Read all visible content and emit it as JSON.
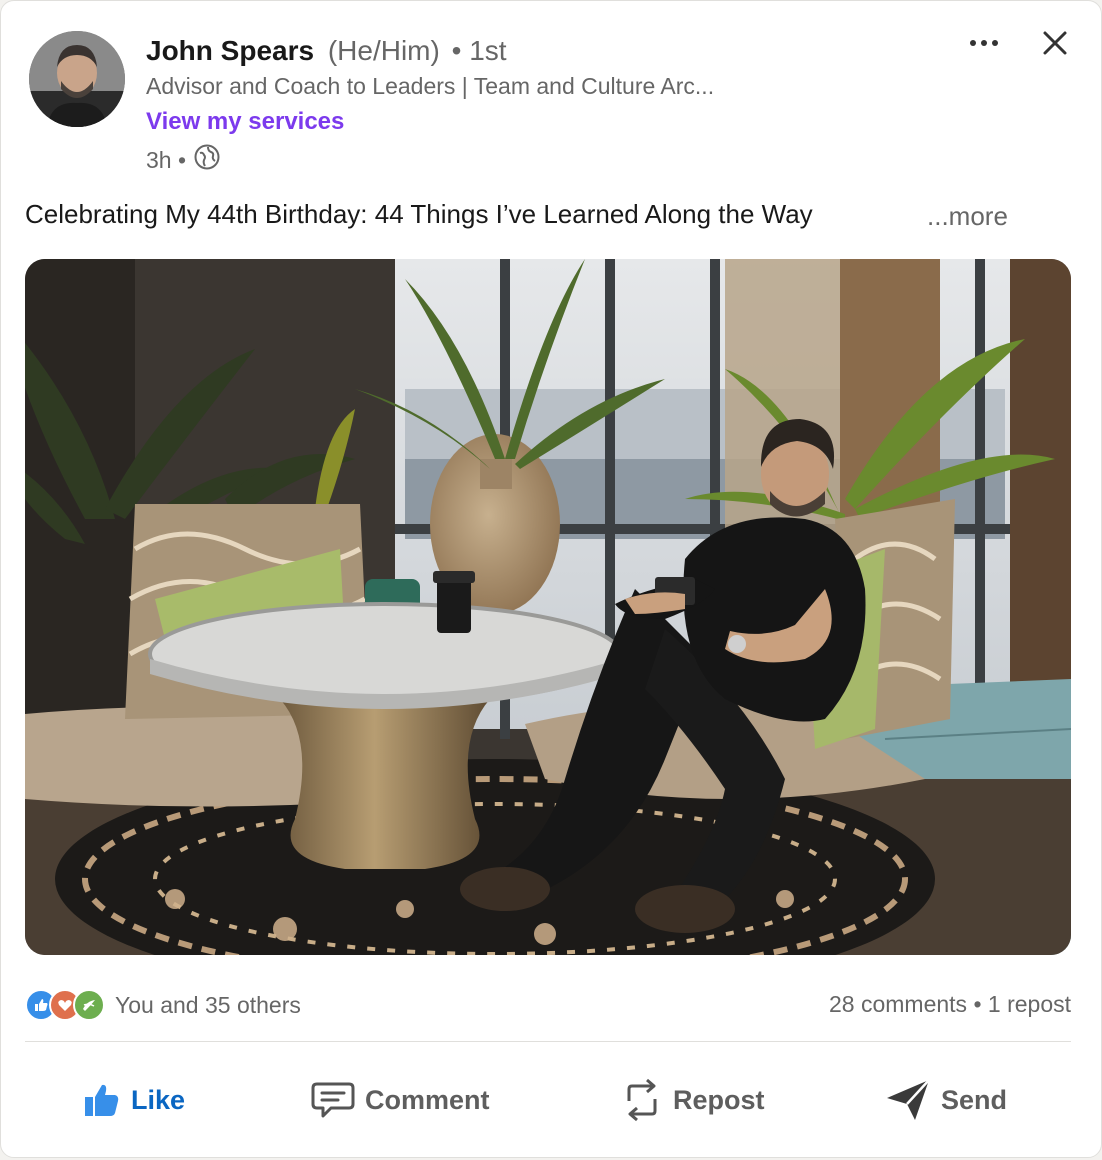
{
  "post": {
    "author": {
      "name": "John Spears",
      "pronouns": "(He/Him)",
      "degree": "• 1st",
      "headline": "Advisor and Coach to Leaders | Team and Culture Arc...",
      "services_link": "View my services"
    },
    "time_ago": "3h •",
    "visibility_icon": "globe-icon",
    "text": "Celebrating My 44th Birthday: 44 Things I’ve Learned Along the Way",
    "see_more": "...more",
    "image": {
      "subject": "photo-man-writing-in-notebook-lounge"
    }
  },
  "social": {
    "reaction_icons": [
      "like-reaction-icon",
      "love-reaction-icon",
      "support-reaction-icon"
    ],
    "reactions_text": "You and 35 others",
    "counts_text": "28 comments • 1 repost"
  },
  "actions": {
    "like": "Like",
    "comment": "Comment",
    "repost": "Repost",
    "send": "Send"
  },
  "colors": {
    "like_blue": "#0a66c2",
    "services_purple": "#7c3aed",
    "muted_text": "#666666"
  }
}
